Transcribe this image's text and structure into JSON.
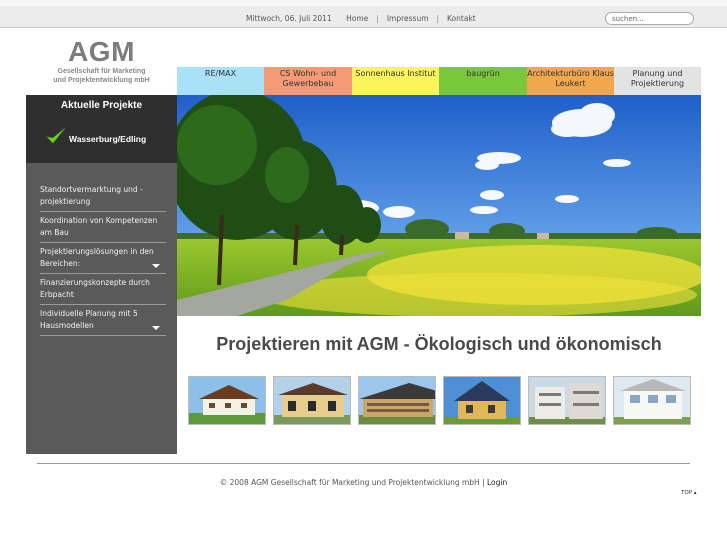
{
  "topbar": {
    "date": "Mittwoch, 06. Juli 2011",
    "links": [
      "Home",
      "Impressum",
      "Kontakt"
    ],
    "search_placeholder": "suchen..."
  },
  "logo": {
    "mark": "AGM",
    "subtitle_line1": "Gesellschaft für Marketing",
    "subtitle_line2": "und Projektentwicklung mbH"
  },
  "partners": [
    {
      "label": "RE/MAX",
      "color": "#a9e1f7"
    },
    {
      "label": "CS Wohn- und Gewerbebau",
      "color": "#f59a75"
    },
    {
      "label": "Sonnenhaus Institut",
      "color": "#f9f35c"
    },
    {
      "label": "baugrün",
      "color": "#7bc73a"
    },
    {
      "label": "Architekturbüro Klaus Leukert",
      "color": "#f1a74b"
    },
    {
      "label": "Planung und Projektierung",
      "color": "#e3e3e3"
    }
  ],
  "sidebar": {
    "title": "Aktuelle Projekte",
    "project": "Wasserburg/Edling",
    "menu": [
      {
        "label": "Standortvermarktung und -projektierung",
        "arrow": false
      },
      {
        "label": "Koordination von Kompetenzen am Bau",
        "arrow": false
      },
      {
        "label": "Projektierungslösungen in den Bereichen:",
        "arrow": true
      },
      {
        "label": "Finanzierungskonzepte durch Erbpacht",
        "arrow": false
      },
      {
        "label": "Individuelle Planung mit 5 Hausmodellen",
        "arrow": true
      }
    ]
  },
  "main": {
    "headline": "Projektieren mit AGM - Ökologisch und ökonomisch"
  },
  "footer": {
    "copyright": "© 2008 AGM Gesellschaft für Marketing und Projektentwicklung mbH |",
    "login": "Login",
    "top": "TOP ▴"
  },
  "colors": {
    "sidebar_bg": "#5a5a5a",
    "sidebar_head_bg": "#2f2f2f",
    "check": "#6fd32b"
  }
}
